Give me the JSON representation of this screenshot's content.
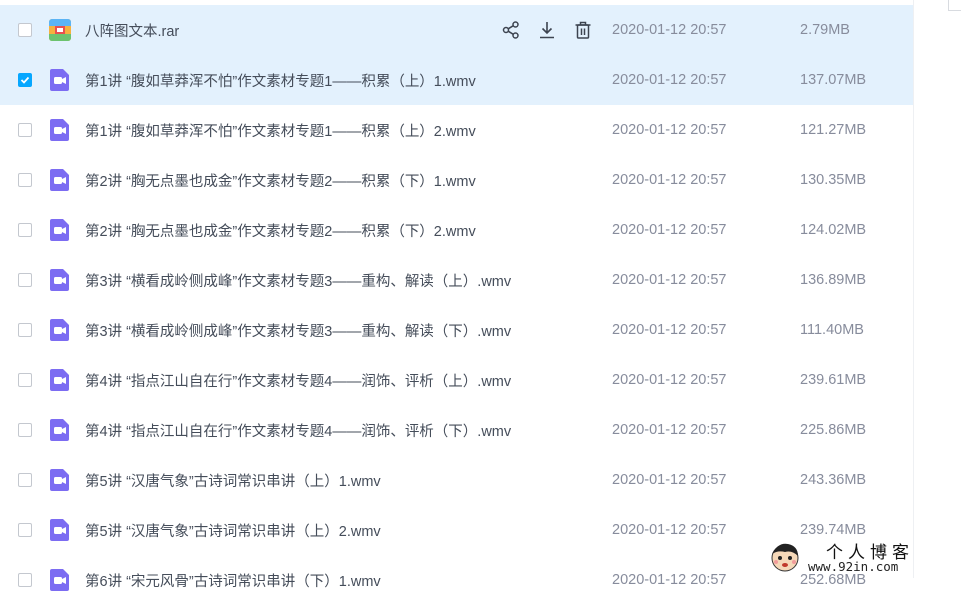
{
  "colors": {
    "accent": "#06a7ff",
    "row_highlight": "#e3f1fd",
    "video_icon": "#7c6cf2",
    "rar_icon": "#f2a43a"
  },
  "row_actions": {
    "share_icon": "share-icon",
    "download_icon": "download-icon",
    "delete_icon": "trash-icon"
  },
  "files": [
    {
      "name": "八阵图文本.rar",
      "date": "2020-01-12 20:57",
      "size": "2.79MB",
      "type": "rar",
      "checked": false,
      "hover": true
    },
    {
      "name": "第1讲 “腹如草莽浑不怕”作文素材专题1——积累（上）1.wmv",
      "date": "2020-01-12 20:57",
      "size": "137.07MB",
      "type": "video",
      "checked": true,
      "hover": false
    },
    {
      "name": "第1讲 “腹如草莽浑不怕”作文素材专题1——积累（上）2.wmv",
      "date": "2020-01-12 20:57",
      "size": "121.27MB",
      "type": "video",
      "checked": false,
      "hover": false
    },
    {
      "name": "第2讲 “胸无点墨也成金”作文素材专题2——积累（下）1.wmv",
      "date": "2020-01-12 20:57",
      "size": "130.35MB",
      "type": "video",
      "checked": false,
      "hover": false
    },
    {
      "name": "第2讲 “胸无点墨也成金”作文素材专题2——积累（下）2.wmv",
      "date": "2020-01-12 20:57",
      "size": "124.02MB",
      "type": "video",
      "checked": false,
      "hover": false
    },
    {
      "name": "第3讲 “横看成岭侧成峰”作文素材专题3——重构、解读（上）.wmv",
      "date": "2020-01-12 20:57",
      "size": "136.89MB",
      "type": "video",
      "checked": false,
      "hover": false
    },
    {
      "name": "第3讲 “横看成岭侧成峰”作文素材专题3——重构、解读（下）.wmv",
      "date": "2020-01-12 20:57",
      "size": "111.40MB",
      "type": "video",
      "checked": false,
      "hover": false
    },
    {
      "name": "第4讲 “指点江山自在行”作文素材专题4——润饰、评析（上）.wmv",
      "date": "2020-01-12 20:57",
      "size": "239.61MB",
      "type": "video",
      "checked": false,
      "hover": false
    },
    {
      "name": "第4讲 “指点江山自在行”作文素材专题4——润饰、评析（下）.wmv",
      "date": "2020-01-12 20:57",
      "size": "225.86MB",
      "type": "video",
      "checked": false,
      "hover": false
    },
    {
      "name": "第5讲 “汉唐气象”古诗词常识串讲（上）1.wmv",
      "date": "2020-01-12 20:57",
      "size": "243.36MB",
      "type": "video",
      "checked": false,
      "hover": false
    },
    {
      "name": "第5讲 “汉唐气象”古诗词常识串讲（上）2.wmv",
      "date": "2020-01-12 20:57",
      "size": "239.74MB",
      "type": "video",
      "checked": false,
      "hover": false
    },
    {
      "name": "第6讲 “宋元风骨”古诗词常识串讲（下）1.wmv",
      "date": "2020-01-12 20:57",
      "size": "252.68MB",
      "type": "video",
      "checked": false,
      "hover": false
    }
  ],
  "watermark": {
    "title": "个人博客",
    "url": "www.92in.com"
  }
}
